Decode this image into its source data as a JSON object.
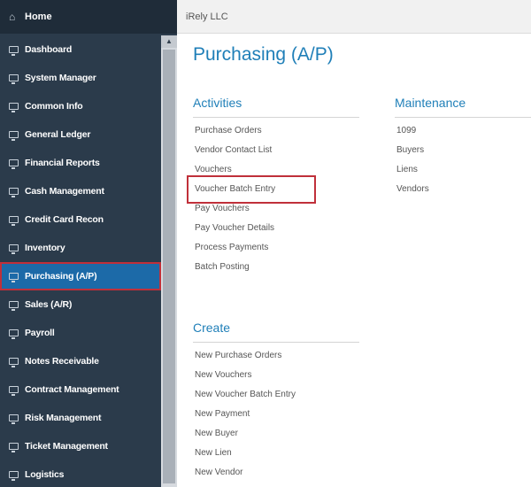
{
  "sidebar": {
    "home_label": "Home",
    "items": [
      {
        "label": "Dashboard"
      },
      {
        "label": "System Manager"
      },
      {
        "label": "Common Info"
      },
      {
        "label": "General Ledger"
      },
      {
        "label": "Financial Reports"
      },
      {
        "label": "Cash Management"
      },
      {
        "label": "Credit Card Recon"
      },
      {
        "label": "Inventory"
      },
      {
        "label": "Purchasing (A/P)"
      },
      {
        "label": "Sales (A/R)"
      },
      {
        "label": "Payroll"
      },
      {
        "label": "Notes Receivable"
      },
      {
        "label": "Contract Management"
      },
      {
        "label": "Risk Management"
      },
      {
        "label": "Ticket Management"
      },
      {
        "label": "Logistics"
      }
    ],
    "active_item": "Purchasing (A/P)"
  },
  "topbar": {
    "company": "iRely LLC"
  },
  "main": {
    "title": "Purchasing (A/P)",
    "activities": {
      "title": "Activities",
      "links": [
        "Purchase Orders",
        "Vendor Contact List",
        "Vouchers",
        "Voucher Batch Entry",
        "Pay Vouchers",
        "Pay Voucher Details",
        "Process Payments",
        "Batch Posting"
      ]
    },
    "maintenance": {
      "title": "Maintenance",
      "links": [
        "1099",
        "Buyers",
        "Liens",
        "Vendors"
      ]
    },
    "create": {
      "title": "Create",
      "links": [
        "New Purchase Orders",
        "New Vouchers",
        "New Voucher Batch Entry",
        "New Payment",
        "New Buyer",
        "New Lien",
        "New Vendor"
      ]
    }
  },
  "colors": {
    "sidebar_bg": "#2b3b4b",
    "active_bg": "#1c6aa8",
    "accent_blue": "#1f7fb8",
    "highlight_red": "#c0303a"
  }
}
